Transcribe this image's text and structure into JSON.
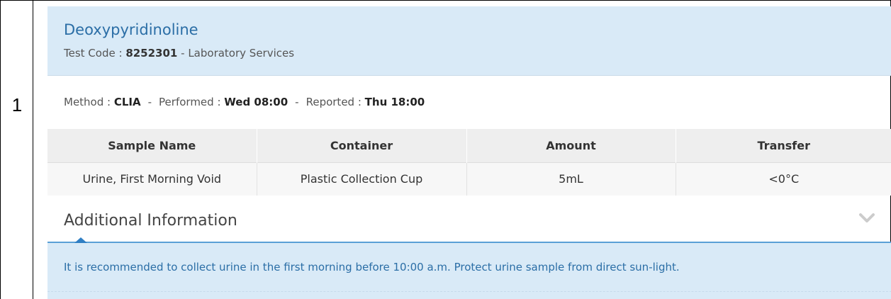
{
  "row": {
    "index": "1"
  },
  "test": {
    "name": "Deoxypyridinoline",
    "code_label": "Test Code : ",
    "code": "8252301",
    "code_suffix": " - Laboratory Services"
  },
  "method": {
    "method_label": "Method : ",
    "method_value": "CLIA",
    "performed_label": "Performed : ",
    "performed_value": "Wed 08:00",
    "reported_label": "Reported : ",
    "reported_value": "Thu 18:00",
    "separator": "-"
  },
  "samples": {
    "headers": [
      "Sample Name",
      "Container",
      "Amount",
      "Transfer"
    ],
    "rows": [
      [
        "Urine, First Morning Void",
        "Plastic Collection Cup",
        "5mL",
        "<0°C"
      ]
    ]
  },
  "additional": {
    "title": "Additional Information",
    "expand_icon": "chevron-down-icon",
    "text": "It is recommended to collect urine in the first morning before 10:00 a.m. Protect urine sample from direct sun-light."
  },
  "colors": {
    "header_bg": "#d9eaf7",
    "link_blue": "#2b6ea6",
    "accent_blue": "#5aa0d6"
  }
}
